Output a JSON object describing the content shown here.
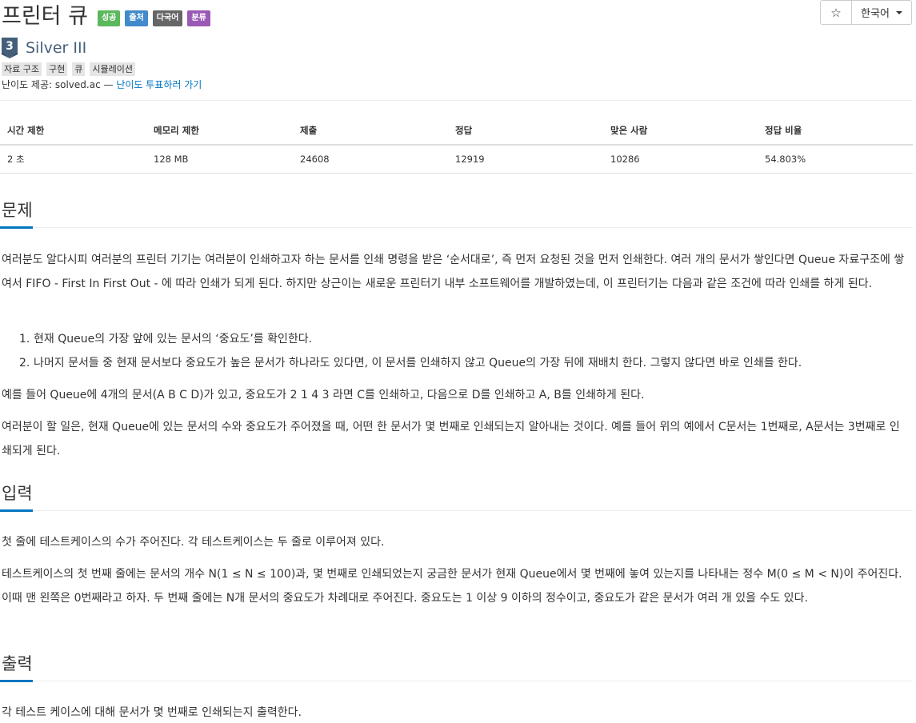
{
  "header": {
    "title": "프린터 큐",
    "labels": [
      {
        "text": "성공",
        "color": "#5cb85c"
      },
      {
        "text": "출처",
        "color": "#428bca"
      },
      {
        "text": "다국어",
        "color": "#666666"
      },
      {
        "text": "분류",
        "color": "#9b59b6"
      }
    ],
    "star_glyph": "☆",
    "language": "한국어"
  },
  "tier": {
    "number": "3",
    "name": "Silver III",
    "color": "#435f7a"
  },
  "tags": [
    "자료 구조",
    "구현",
    "큐",
    "시뮬레이션"
  ],
  "credit": {
    "prefix": "난이도 제공: solved.ac —",
    "link": "난이도 투표하러 가기"
  },
  "info_table": {
    "headers": [
      "시간 제한",
      "메모리 제한",
      "제출",
      "정답",
      "맞은 사람",
      "정답 비율"
    ],
    "values": [
      "2 초",
      "128 MB",
      "24608",
      "12919",
      "10286",
      "54.803%"
    ]
  },
  "problem": {
    "heading": "문제",
    "para1": "여러분도 알다시피 여러분의 프린터 기기는 여러분이 인쇄하고자 하는 문서를 인쇄 명령을 받은 ‘순서대로’, 즉 먼저 요청된 것을 먼저 인쇄한다. 여러 개의 문서가 쌓인다면 Queue 자료구조에 쌓여서 FIFO - First In First Out - 에 따라 인쇄가 되게 된다. 하지만 상근이는 새로운 프린터기 내부 소프트웨어를 개발하였는데, 이 프린터기는 다음과 같은 조건에 따라 인쇄를 하게 된다.",
    "steps": [
      {
        "num": "1.",
        "text": "현재 Queue의 가장 앞에 있는 문서의 ‘중요도’를 확인한다."
      },
      {
        "num": "2.",
        "text": "나머지 문서들 중 현재 문서보다 중요도가 높은 문서가 하나라도 있다면, 이 문서를 인쇄하지 않고 Queue의 가장 뒤에 재배치 한다. 그렇지 않다면 바로 인쇄를 한다."
      }
    ],
    "para2": "예를 들어 Queue에 4개의 문서(A B C D)가 있고, 중요도가 2 1 4 3 라면 C를 인쇄하고, 다음으로 D를 인쇄하고 A, B를 인쇄하게 된다.",
    "para3": "여러분이 할 일은, 현재 Queue에 있는 문서의 수와 중요도가 주어졌을 때, 어떤 한 문서가 몇 번째로 인쇄되는지 알아내는 것이다. 예를 들어 위의 예에서 C문서는 1번째로, A문서는 3번째로 인쇄되게 된다."
  },
  "input": {
    "heading": "입력",
    "para1": "첫 줄에 테스트케이스의 수가 주어진다. 각 테스트케이스는 두 줄로 이루어져 있다.",
    "para2": "테스트케이스의 첫 번째 줄에는 문서의 개수 N(1 ≤ N ≤ 100)과, 몇 번째로 인쇄되었는지 궁금한 문서가 현재 Queue에서 몇 번째에 놓여 있는지를 나타내는 정수 M(0 ≤ M < N)이 주어진다. 이때 맨 왼쪽은 0번째라고 하자. 두 번째 줄에는 N개 문서의 중요도가 차례대로 주어진다. 중요도는 1 이상 9 이하의 정수이고, 중요도가 같은 문서가 여러 개 있을 수도 있다."
  },
  "output": {
    "heading": "출력",
    "para1": "각 테스트 케이스에 대해 문서가 몇 번째로 인쇄되는지 출력한다."
  }
}
